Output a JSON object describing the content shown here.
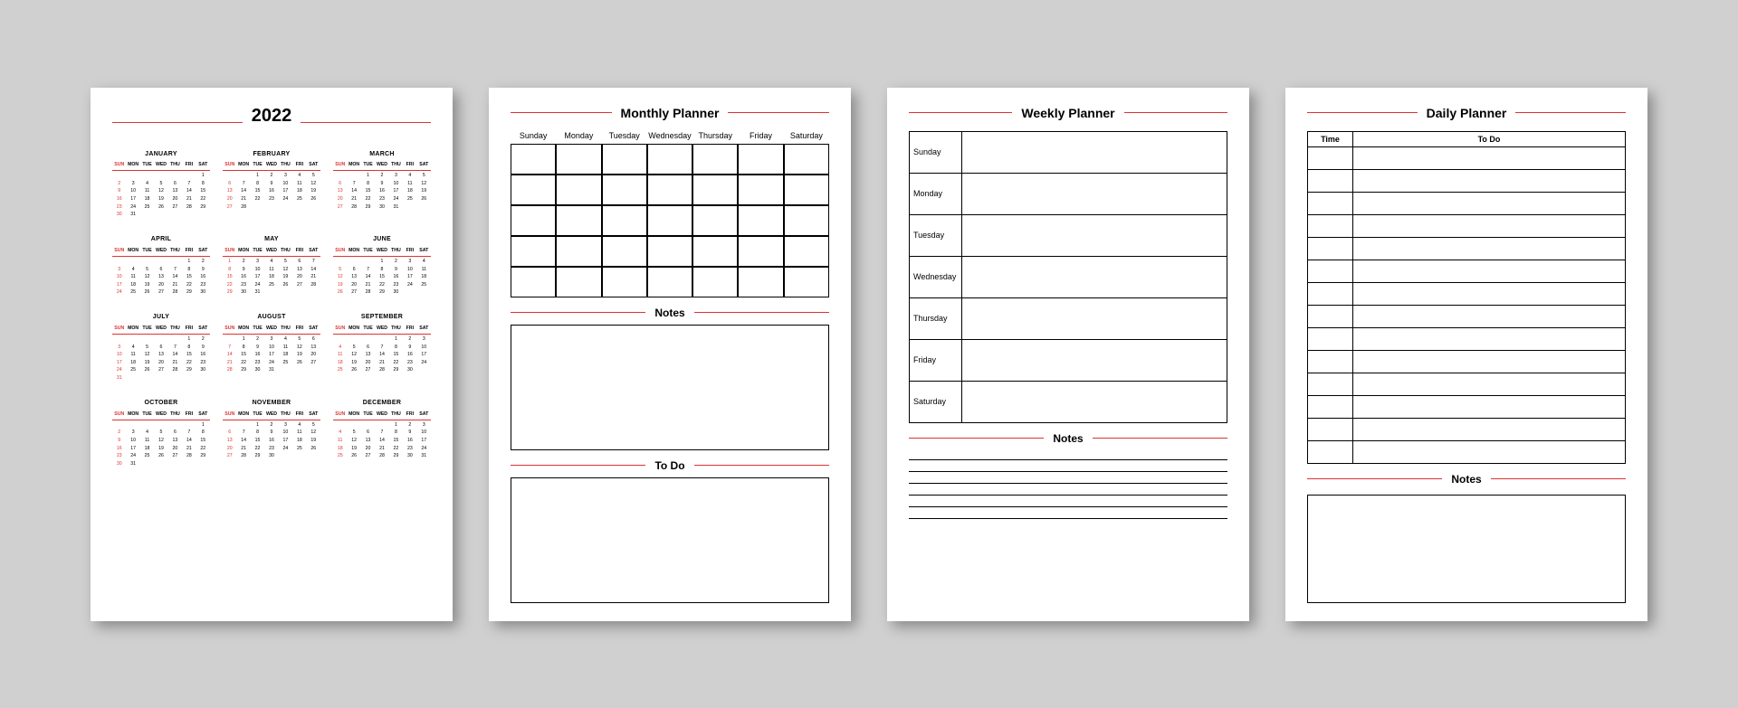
{
  "year": {
    "title": "2022",
    "dow": [
      "SUN",
      "MON",
      "TUE",
      "WED",
      "THU",
      "FRI",
      "SAT"
    ],
    "months": [
      {
        "name": "JANUARY",
        "start": 6,
        "days": 31
      },
      {
        "name": "FEBRUARY",
        "start": 2,
        "days": 28
      },
      {
        "name": "MARCH",
        "start": 2,
        "days": 31
      },
      {
        "name": "APRIL",
        "start": 5,
        "days": 30
      },
      {
        "name": "MAY",
        "start": 0,
        "days": 31
      },
      {
        "name": "JUNE",
        "start": 3,
        "days": 30
      },
      {
        "name": "JULY",
        "start": 5,
        "days": 31
      },
      {
        "name": "AUGUST",
        "start": 1,
        "days": 31
      },
      {
        "name": "SEPTEMBER",
        "start": 4,
        "days": 30
      },
      {
        "name": "OCTOBER",
        "start": 6,
        "days": 31
      },
      {
        "name": "NOVEMBER",
        "start": 2,
        "days": 30
      },
      {
        "name": "DECEMBER",
        "start": 4,
        "days": 31
      }
    ]
  },
  "monthly": {
    "title": "Monthly Planner",
    "dow": [
      "Sunday",
      "Monday",
      "Tuesday",
      "Wednesday",
      "Thursday",
      "Friday",
      "Saturday"
    ],
    "notes_label": "Notes",
    "todo_label": "To Do"
  },
  "weekly": {
    "title": "Weekly Planner",
    "days": [
      "Sunday",
      "Monday",
      "Tuesday",
      "Wednesday",
      "Thursday",
      "Friday",
      "Saturday"
    ],
    "notes_label": "Notes",
    "note_line_count": 6
  },
  "daily": {
    "title": "Daily Planner",
    "time_label": "Time",
    "todo_label": "To Do",
    "row_count": 14,
    "notes_label": "Notes"
  }
}
